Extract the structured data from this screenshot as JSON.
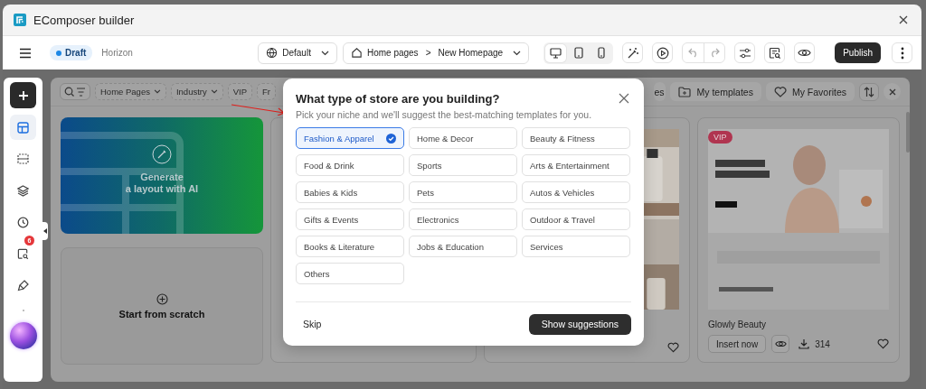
{
  "window": {
    "title": "EComposer builder"
  },
  "toolbar": {
    "status": "Draft",
    "theme": "Horizon",
    "language": "Default",
    "breadcrumb": [
      "Home pages",
      "New Homepage"
    ],
    "separator": ">",
    "devices": [
      {
        "kind": "desktop",
        "selected": true
      },
      {
        "kind": "tablet",
        "selected": false
      },
      {
        "kind": "mobile",
        "selected": false
      }
    ],
    "publish": "Publish"
  },
  "sidebar": {
    "items": [
      {
        "kind": "templates",
        "selected": true
      },
      {
        "kind": "sections",
        "selected": false
      },
      {
        "kind": "layers",
        "selected": false
      },
      {
        "kind": "history",
        "selected": false
      },
      {
        "kind": "search",
        "selected": false,
        "badge": "6"
      },
      {
        "kind": "brush",
        "selected": false
      }
    ]
  },
  "templates_panel": {
    "filters": [
      "Home Pages",
      "Industry",
      "VIP",
      "Fr"
    ],
    "tabs": [
      {
        "kind": "partial",
        "label": "es"
      },
      {
        "kind": "folder",
        "label": "My templates"
      },
      {
        "kind": "heart",
        "label": "My Favorites"
      }
    ],
    "ai_card": {
      "lines": [
        "Generate",
        "a layout with AI"
      ]
    },
    "scratch_card": {
      "label": "Start from scratch"
    },
    "cards": [
      {
        "kind": "hidden"
      },
      {
        "kind": "picture"
      },
      {
        "kind": "template",
        "badge": "VIP",
        "name": "Glowly Beauty",
        "insert": "Insert now",
        "downloads": "314"
      }
    ]
  },
  "dialog": {
    "title": "What type of store are you building?",
    "subtitle": "Pick your niche and we'll suggest the best-matching templates for you.",
    "options": [
      {
        "label": "Fashion & Apparel",
        "selected": true
      },
      {
        "label": "Home & Decor",
        "selected": false
      },
      {
        "label": "Beauty & Fitness",
        "selected": false
      },
      {
        "label": "Food & Drink",
        "selected": false
      },
      {
        "label": "Sports",
        "selected": false
      },
      {
        "label": "Arts & Entertainment",
        "selected": false
      },
      {
        "label": "Babies & Kids",
        "selected": false
      },
      {
        "label": "Pets",
        "selected": false
      },
      {
        "label": "Autos & Vehicles",
        "selected": false
      },
      {
        "label": "Gifts & Events",
        "selected": false
      },
      {
        "label": "Electronics",
        "selected": false
      },
      {
        "label": "Outdoor & Travel",
        "selected": false
      },
      {
        "label": "Books & Literature",
        "selected": false
      },
      {
        "label": "Jobs & Education",
        "selected": false
      },
      {
        "label": "Services",
        "selected": false
      },
      {
        "label": "Others",
        "selected": false
      }
    ],
    "skip": "Skip",
    "confirm": "Show suggestions"
  }
}
